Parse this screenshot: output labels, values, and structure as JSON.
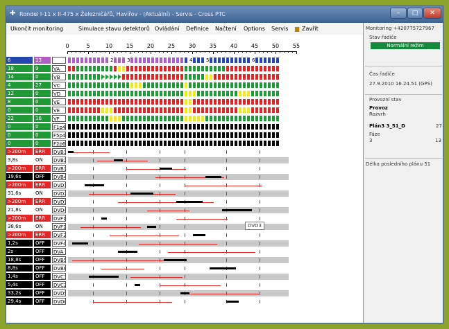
{
  "window": {
    "title": "Rondel I-11 x II-475 x Železničářů, Havířov - (Aktuální) - Servis - Cross PTC",
    "controls": [
      "–",
      "□",
      "✕"
    ]
  },
  "menu": [
    "Ukončit monitoring",
    "Simulace stavu detektorů",
    "Ovládání",
    "Definice",
    "Načtení",
    "Options",
    "Servis",
    "Zavřít"
  ],
  "ruler": {
    "labels": [
      "0",
      "5",
      "10",
      "15",
      "20",
      "25",
      "30",
      "35",
      "40",
      "45",
      "50",
      "55"
    ],
    "max": 55
  },
  "colors": {
    "red": "#e32424",
    "green": "#1f9a36",
    "yellow": "#f1ea1a",
    "black": "#000000",
    "purple": "#b05ec2",
    "blue": "#2547b0",
    "white": "#ffffff",
    "status_green": "#168a3c"
  },
  "header_row": {
    "a": "6",
    "b": "13",
    "markers": [
      {
        "pos": 10,
        "text": "2"
      },
      {
        "pos": 14,
        "text": "3"
      },
      {
        "pos": 29,
        "text": "4"
      },
      {
        "pos": 33,
        "text": "5"
      },
      {
        "pos": 44,
        "text": "6"
      }
    ]
  },
  "signal_rows": [
    {
      "a": "18",
      "b": "9",
      "name": "VA",
      "runs": [
        [
          "r",
          0,
          2
        ],
        [
          "g",
          2,
          11
        ],
        [
          "r",
          11,
          12
        ],
        [
          "y",
          12,
          14
        ],
        [
          "r",
          14,
          28
        ],
        [
          "g",
          28,
          38
        ],
        [
          "r",
          38,
          51
        ]
      ]
    },
    {
      "a": "14",
      "b": "0",
      "name": "VB",
      "runs": [
        [
          "g",
          0,
          8
        ],
        [
          "ga",
          8,
          13
        ],
        [
          "r",
          13,
          28
        ],
        [
          "g",
          28,
          33
        ],
        [
          "y",
          33,
          35
        ],
        [
          "r",
          35,
          51
        ]
      ]
    },
    {
      "a": "4",
      "b": "27",
      "name": "VC",
      "runs": [
        [
          "g",
          0,
          15
        ],
        [
          "y",
          15,
          18
        ],
        [
          "g",
          18,
          28
        ],
        [
          "y",
          28,
          29
        ],
        [
          "g",
          29,
          51
        ]
      ]
    },
    {
      "a": "12",
      "b": "0",
      "name": "VD",
      "runs": [
        [
          "g",
          0,
          28
        ],
        [
          "y",
          28,
          31
        ],
        [
          "g",
          31,
          41
        ],
        [
          "y",
          41,
          44
        ],
        [
          "g",
          44,
          51
        ]
      ]
    },
    {
      "a": "8",
      "b": "0",
      "name": "VE",
      "runs": [
        [
          "r",
          0,
          28
        ],
        [
          "y",
          28,
          30
        ],
        [
          "r",
          30,
          51
        ]
      ]
    },
    {
      "a": "0",
      "b": "0",
      "name": "VE",
      "runs": [
        [
          "r",
          0,
          8
        ],
        [
          "y",
          8,
          11
        ],
        [
          "r",
          11,
          28
        ],
        [
          "y",
          28,
          30
        ],
        [
          "r",
          30,
          41
        ],
        [
          "y",
          41,
          44
        ],
        [
          "r",
          44,
          51
        ]
      ]
    },
    {
      "a": "22",
      "b": "16",
      "name": "VF",
      "runs": [
        [
          "g",
          0,
          10
        ],
        [
          "y",
          10,
          13
        ],
        [
          "g",
          13,
          28
        ],
        [
          "y",
          28,
          33
        ],
        [
          "g",
          33,
          51
        ]
      ]
    },
    {
      "a": "0",
      "b": "0",
      "name": "F1p4",
      "runs": [
        [
          "k",
          0,
          51
        ]
      ]
    },
    {
      "a": "0",
      "b": "0",
      "name": "F5p4",
      "runs": [
        [
          "k",
          0,
          51
        ]
      ]
    },
    {
      "a": "0",
      "b": "0",
      "name": "F2p6",
      "runs": [
        [
          "k",
          0,
          51
        ]
      ]
    }
  ],
  "detector_rows": [
    {
      "a": ">200m",
      "b": "ERR",
      "name": "DVB1"
    },
    {
      "a": "3,8s",
      "b": "ON",
      "name": "DVB2"
    },
    {
      "a": ">200m",
      "b": "ERR",
      "name": "DVB3"
    },
    {
      "a": "19,6s",
      "b": "OFF",
      "name": "DVB4"
    },
    {
      "a": ">200m",
      "b": "ERR",
      "name": "DVD1"
    },
    {
      "a": "31,6s",
      "b": "ON",
      "name": "DVD2"
    },
    {
      "a": ">200m",
      "b": "ERR",
      "name": "DVD3"
    },
    {
      "a": "21,8s",
      "b": "ON",
      "name": "DVD4"
    },
    {
      "a": ">200m",
      "b": "ERR",
      "name": "DVF1"
    },
    {
      "a": "38,6s",
      "b": "ON",
      "name": "DVF2"
    },
    {
      "a": ">200m",
      "b": "ERR",
      "name": "DVF3"
    },
    {
      "a": "1,2s",
      "b": "OFF",
      "name": "DVF4"
    },
    {
      "a": "2s",
      "b": "OFF",
      "name": "DVA"
    },
    {
      "a": "18,8s",
      "b": "OFF",
      "name": "DVB5"
    },
    {
      "a": "8,8s",
      "b": "OFF",
      "name": "DVB6"
    },
    {
      "a": "1,4s",
      "b": "OFF",
      "name": "DVC1"
    },
    {
      "a": "5,4s",
      "b": "OFF",
      "name": "DVC2"
    },
    {
      "a": "33,2s",
      "b": "OFF",
      "name": "DVD5"
    },
    {
      "a": "29,4s",
      "b": "OFF",
      "name": "DVD6"
    }
  ],
  "tooltip": "DVD3",
  "panel": {
    "monitoring": "Monitoring +420775727967",
    "stav_label": "Stav řadiče",
    "stav_value": "Normální režim",
    "cas_label": "Čas řadiče",
    "cas_value": "27.9.2010 16.24.51 (GPS)",
    "provozni_label": "Provozní stav",
    "provoz": "Provoz",
    "rozvrh": "Rozvrh",
    "plan_label": "Plán3  3_51_D",
    "plan_value": "27",
    "faze_label": "Fáze",
    "faze_value": "3",
    "faze_value2": "13",
    "delka": "Délka posledního plánu 51"
  }
}
